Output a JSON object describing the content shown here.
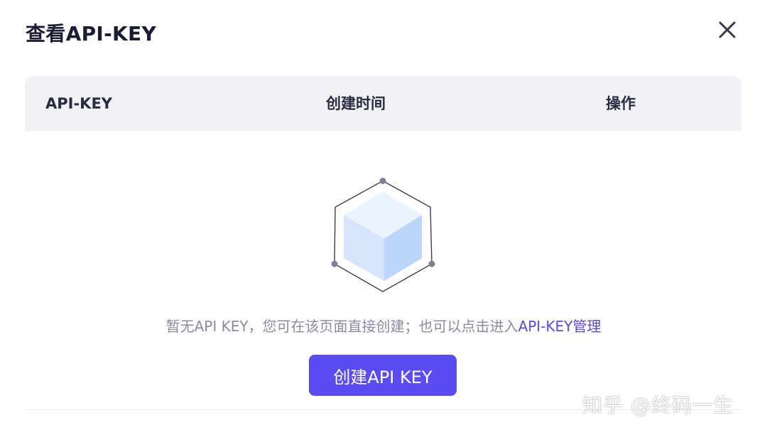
{
  "dialog": {
    "title": "查看API-KEY",
    "close_icon": "close-icon"
  },
  "table": {
    "columns": [
      "API-KEY",
      "创建时间",
      "操作"
    ],
    "rows": []
  },
  "empty_state": {
    "illustration_icon": "empty-box-icon",
    "message_prefix": "暂无API KEY，您可在该页面直接创建；也可以点击进入",
    "link_text": "API-KEY管理"
  },
  "actions": {
    "create_label": "创建API KEY"
  },
  "watermark": {
    "text": "知乎 @终码一生"
  },
  "colors": {
    "primary": "#5b4cf2",
    "link": "#5a48e6",
    "header_bg": "#f1f1f6",
    "muted_text": "#8a8aa4"
  }
}
